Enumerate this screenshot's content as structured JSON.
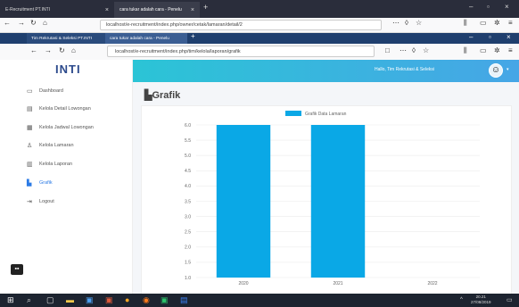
{
  "outer_browser": {
    "tabs": [
      "E-Recruitment PT.INTI",
      "cara tukar adalah cara - Penelu"
    ],
    "url": "localhost/e-recruitment/index.php/owner/cetak/lamaran/detail/2"
  },
  "inner_browser": {
    "tabs": [
      "Tim Rekrutasi & Seleksi PT.INTI",
      "cara tukar adalah cara - Penelu"
    ],
    "url": "localhost/e-recruitment/index.php/tim/kelola/laporan/grafik"
  },
  "app": {
    "logo": "INTI",
    "greeting": "Hallo, Tim Rekrutasi & Seleksi",
    "page_title": "Grafik",
    "menu": [
      {
        "label": "Dashboard",
        "icon": "monitor-icon"
      },
      {
        "label": "Kelola Detail Lowongan",
        "icon": "file-icon"
      },
      {
        "label": "Kelola Jadwal Lowongan",
        "icon": "calendar-icon"
      },
      {
        "label": "Kelola Lamaran",
        "icon": "person-icon"
      },
      {
        "label": "Kelola Laporan",
        "icon": "report-icon"
      },
      {
        "label": "Grafik",
        "icon": "chart-icon"
      },
      {
        "label": "Logout",
        "icon": "logout-icon"
      }
    ],
    "active_menu": "Grafik"
  },
  "taskbar": {
    "time": "20.21",
    "date": "27/08/2019"
  },
  "chart_data": {
    "type": "bar",
    "categories": [
      "2020",
      "2021",
      "2022"
    ],
    "series": [
      {
        "name": "Grafik Data Lamaran",
        "values": [
          6,
          6,
          0
        ],
        "color": "#0aa8e6"
      }
    ],
    "ylim": [
      1.0,
      6.0
    ],
    "yticks": [
      "1.0",
      "1.5",
      "2.0",
      "2.5",
      "3.0",
      "3.5",
      "4.0",
      "4.5",
      "5.0",
      "5.5",
      "6.0"
    ],
    "legend": "top-center"
  }
}
